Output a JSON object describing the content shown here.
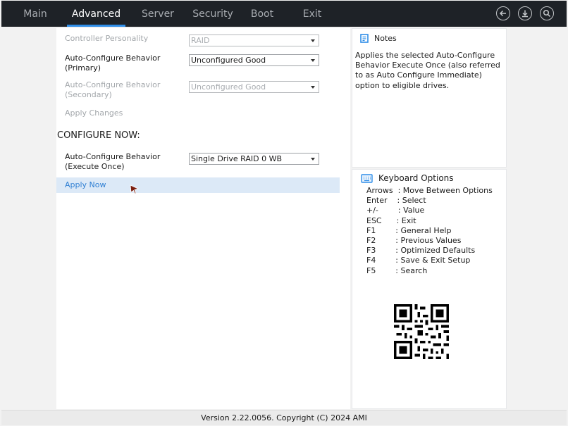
{
  "menu": {
    "tabs": [
      {
        "label": "Main"
      },
      {
        "label": "Advanced",
        "active": true
      },
      {
        "label": "Server"
      },
      {
        "label": "Security"
      },
      {
        "label": "Boot"
      },
      {
        "label": "Exit"
      }
    ]
  },
  "icons": [
    "back-icon",
    "download-icon",
    "search-icon"
  ],
  "settings": {
    "controller_personality": {
      "label": "Controller Personality",
      "value": "RAID"
    },
    "auto_primary": {
      "label_line1": "Auto-Configure Behavior",
      "label_line2": "(Primary)",
      "value": "Unconfigured Good"
    },
    "auto_secondary": {
      "label_line1": "Auto-Configure Behavior",
      "label_line2": "(Secondary)",
      "value": "Unconfigured Good"
    },
    "apply_changes": "Apply Changes",
    "configure_now_title": "CONFIGURE NOW:",
    "execute_once": {
      "label_line1": "Auto-Configure Behavior",
      "label_line2": "(Execute Once)",
      "value": "Single Drive RAID 0 WB"
    },
    "apply_now": "Apply Now"
  },
  "notes": {
    "title": "Notes",
    "text": "Applies the selected Auto-Configure Behavior Execute Once (also referred to as Auto Configure Immediate) option to eligible drives."
  },
  "keyboard": {
    "title": "Keyboard Options",
    "items": [
      "Arrows  : Move Between Options",
      "Enter    : Select",
      "+/-        : Value",
      "ESC      : Exit",
      "F1        : General Help",
      "F2        : Previous Values",
      "F3        : Optimized Defaults",
      "F4        : Save & Exit Setup",
      "F5        : Search"
    ]
  },
  "footer": {
    "text": "Version 2.22.0056. Copyright (C) 2024 AMI"
  },
  "colors": {
    "accent": "#2f8ee8",
    "topbar": "#1e2227",
    "highlight": "#dce9f7"
  }
}
